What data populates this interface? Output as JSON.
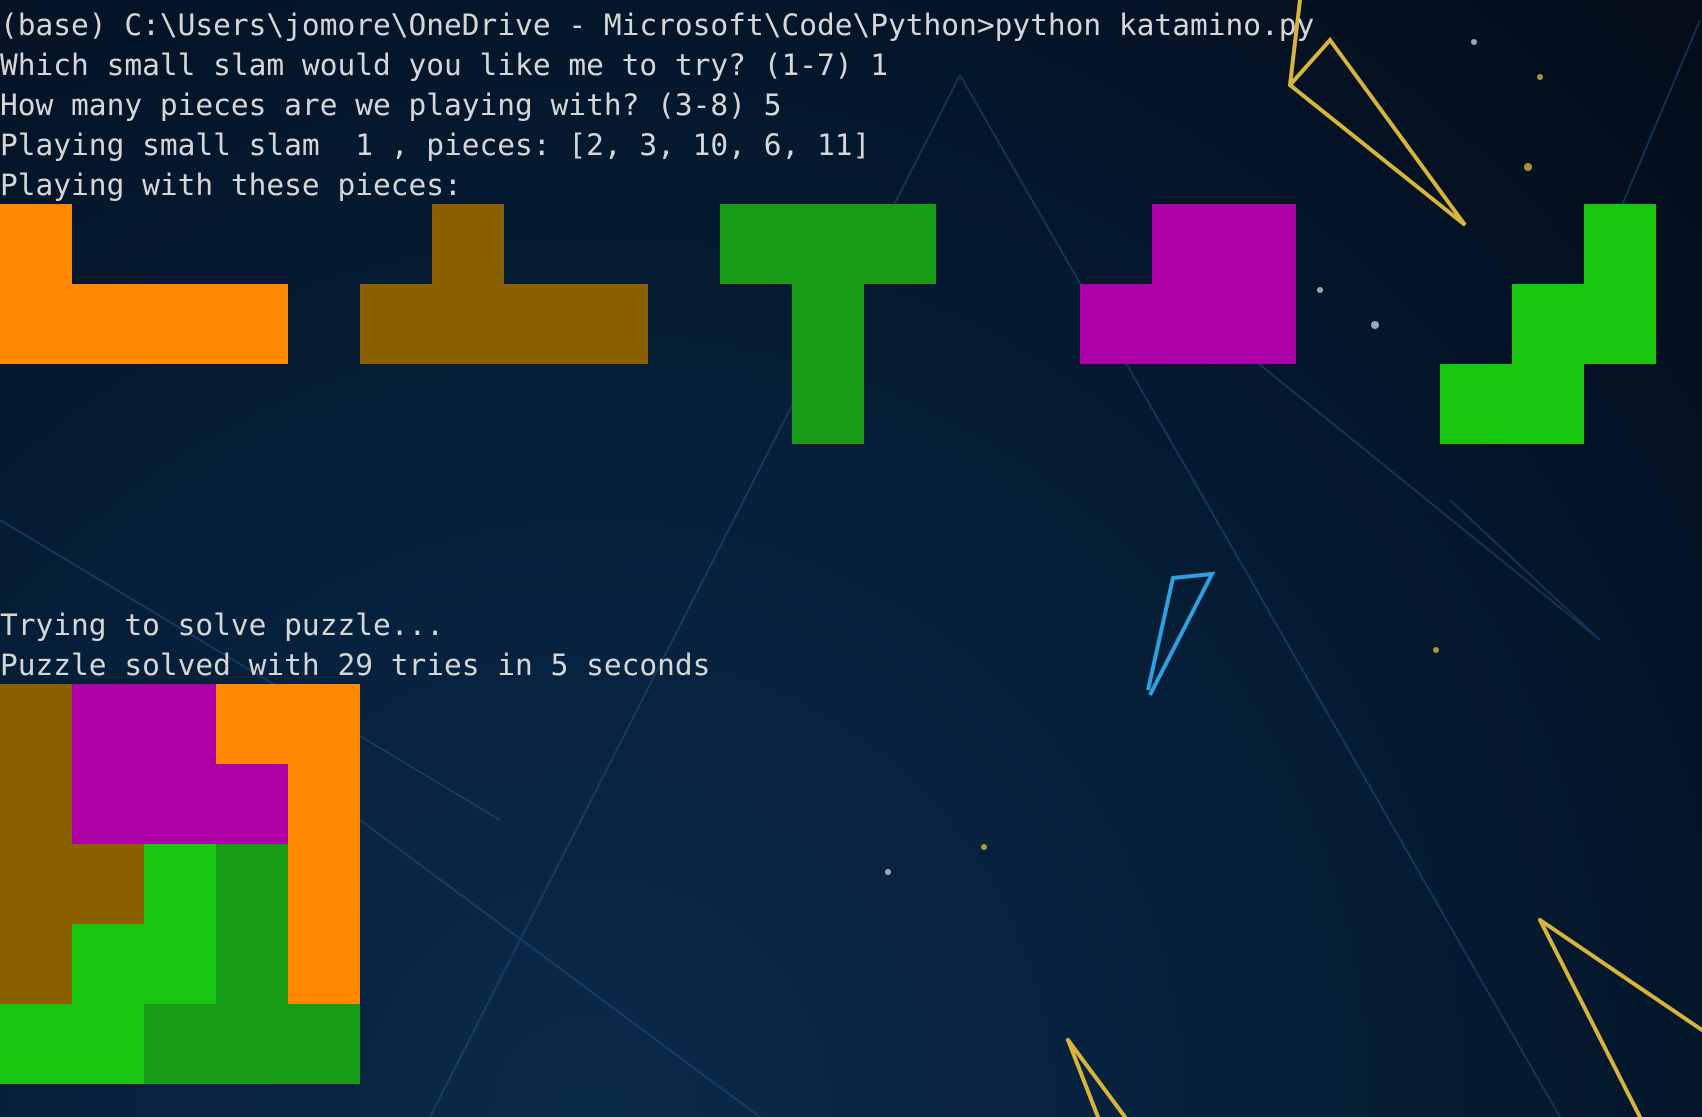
{
  "terminal": {
    "lines": {
      "l0": "(base) C:\\Users\\jomore\\OneDrive - Microsoft\\Code\\Python>python katamino.py",
      "l1": "Which small slam would you like me to try? (1-7) 1",
      "l2": "How many pieces are we playing with? (3-8) 5",
      "l3": "Playing small slam  1 , pieces: [2, 3, 10, 6, 11]",
      "l4": "Playing with these pieces:",
      "l5": "Trying to solve puzzle...",
      "l6": "Puzzle solved with 29 tries in 5 seconds"
    }
  },
  "colors": {
    "orange": "#ff8800",
    "brown": "#8a6000",
    "darkgreen": "#169c16",
    "magenta": "#b000a8",
    "lightgreen": "#17c60d",
    "text": "#d6d6d6"
  },
  "pieces": [
    {
      "name": "piece-2",
      "color": "orange",
      "rows": [
        "X...",
        "XXXX"
      ]
    },
    {
      "name": "piece-3",
      "color": "brown",
      "rows": [
        ".X..",
        "XXXX"
      ]
    },
    {
      "name": "piece-10",
      "color": "darkgreen",
      "rows": [
        "XXX",
        ".X.",
        ".X."
      ]
    },
    {
      "name": "piece-6",
      "color": "magenta",
      "rows": [
        ".XX",
        "XXX"
      ]
    },
    {
      "name": "piece-11",
      "color": "lightgreen",
      "rows": [
        "..X",
        ".XX",
        "XX."
      ]
    }
  ],
  "solution": {
    "rows": [
      [
        "brown",
        "magenta",
        "magenta",
        "orange",
        "orange"
      ],
      [
        "brown",
        "magenta",
        "magenta",
        "magenta",
        "orange"
      ],
      [
        "brown",
        "brown",
        "lightgreen",
        "darkgreen",
        "orange"
      ],
      [
        "brown",
        "lightgreen",
        "lightgreen",
        "darkgreen",
        "orange"
      ],
      [
        "lightgreen",
        "lightgreen",
        "darkgreen",
        "darkgreen",
        "darkgreen"
      ]
    ]
  }
}
